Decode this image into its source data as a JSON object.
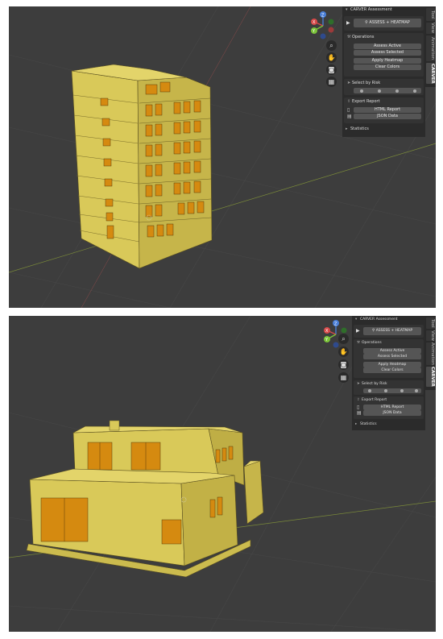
{
  "panel": {
    "title": "CARVER Assessment",
    "assess_heatmap": "ASSESS + HEATMAP",
    "operations_label": "Operations",
    "assess_active": "Assess Active",
    "assess_selected": "Assess Selected",
    "apply_heatmap": "Apply Heatmap",
    "clear_colors": "Clear Colors",
    "select_by_risk": "Select by Risk",
    "export_report": "Export Report",
    "html_report": "HTML Report",
    "json_data": "JSON Data",
    "statistics": "Statistics"
  },
  "tabs": [
    "Tool",
    "View",
    "Animation",
    "CARVER"
  ],
  "active_tab": "CARVER",
  "gizmo": {
    "x": "X",
    "y": "Y",
    "z": "Z"
  },
  "colors": {
    "viewport": "#3d3d3d",
    "building": "#d6c55a",
    "building_shade": "#b3a341",
    "window": "#d58a10",
    "panel_bg": "#2b2b2b",
    "button": "#555555"
  }
}
